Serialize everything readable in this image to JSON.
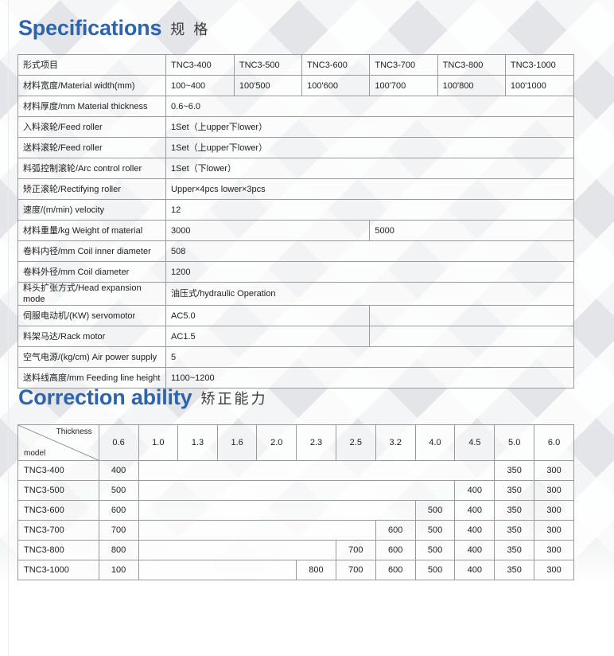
{
  "theme": {
    "heading_color": "#2e63ad",
    "zh_heading_color": "#3b3b3b",
    "border_color": "#9a9a9a",
    "page_background": "#ffffff",
    "band_background": "#f4f5f6"
  },
  "sections": {
    "specifications": {
      "heading_en": "Specifications",
      "heading_zh": "规 格",
      "table": {
        "header": {
          "label": "形式项目",
          "models": [
            "TNC3-400",
            "TNC3-500",
            "TNC3-600",
            "TNC3-700",
            "TNC3-800",
            "TNC3-1000"
          ]
        },
        "rows": [
          {
            "label": "材料宽度/Material width(mm)",
            "type": "per-model",
            "values": [
              "100~400",
              "100'500",
              "100'600",
              "100'700",
              "100'800",
              "100'1000"
            ]
          },
          {
            "label": "材料厚度/mm Material thickness",
            "type": "span-all",
            "value": "0.6~6.0"
          },
          {
            "label": "入料滚轮/Feed roller",
            "type": "span-all",
            "value": "1Set（上upper下lower）"
          },
          {
            "label": "送料滚轮/Feed roller",
            "type": "span-all",
            "value": "1Set（上upper下lower）"
          },
          {
            "label": "料弧控制滚轮/Arc control roller",
            "type": "span-all",
            "value": "1Set（下lower）"
          },
          {
            "label": "矫正滚轮/Rectifying roller",
            "type": "span-all",
            "value": "Upper×4pcs   lower×3pcs"
          },
          {
            "label": "速度/(m/min) velocity",
            "type": "span-all",
            "value": "12"
          },
          {
            "label": "材料重量/kg Weight of material",
            "type": "split-half",
            "value_left": "3000",
            "value_right": "5000"
          },
          {
            "label": "卷料内径/mm Coil inner diameter",
            "type": "span-all",
            "value": "508"
          },
          {
            "label": "卷料外径/mm Coil diameter",
            "type": "span-all",
            "value": "1200"
          },
          {
            "label": "料头扩张方式/Head expansion mode",
            "type": "span-all",
            "value": "油压式/hydraulic Operation"
          },
          {
            "label": "伺服电动机/(KW) servomotor",
            "type": "split-half",
            "value_left": "AC5.0",
            "value_right": ""
          },
          {
            "label": "料架马达/Rack motor",
            "type": "split-half",
            "value_left": "AC1.5",
            "value_right": ""
          },
          {
            "label": "空气电源/(kg/cm) Air power supply",
            "type": "span-all",
            "value": "5"
          },
          {
            "label": "送料线高度/mm Feeding line height",
            "type": "span-all",
            "value": "1100~1200"
          }
        ]
      }
    },
    "correction_ability": {
      "heading_en": "Correction ability",
      "heading_zh": "矫正能力",
      "table": {
        "corner": {
          "top_right": "Thickness",
          "bottom_left": "model"
        },
        "thickness_columns": [
          "0.6",
          "1.0",
          "1.3",
          "1.6",
          "2.0",
          "2.3",
          "2.5",
          "3.2",
          "4.0",
          "4.5",
          "5.0",
          "6.0"
        ],
        "rows": [
          {
            "model": "TNC3-400",
            "values": [
              "400",
              "",
              "",
              "",
              "",
              "",
              "",
              "",
              "",
              "",
              "350",
              "300"
            ]
          },
          {
            "model": "TNC3-500",
            "values": [
              "500",
              "",
              "",
              "",
              "",
              "",
              "",
              "",
              "",
              "400",
              "350",
              "300"
            ]
          },
          {
            "model": "TNC3-600",
            "values": [
              "600",
              "",
              "",
              "",
              "",
              "",
              "",
              "",
              "500",
              "400",
              "350",
              "300"
            ]
          },
          {
            "model": "TNC3-700",
            "values": [
              "700",
              "",
              "",
              "",
              "",
              "",
              "",
              "600",
              "500",
              "400",
              "350",
              "300"
            ]
          },
          {
            "model": "TNC3-800",
            "values": [
              "800",
              "",
              "",
              "",
              "",
              "",
              "700",
              "600",
              "500",
              "400",
              "350",
              "300"
            ]
          },
          {
            "model": "TNC3-1000",
            "values": [
              "100",
              "",
              "",
              "",
              "",
              "800",
              "700",
              "600",
              "500",
              "400",
              "350",
              "300"
            ]
          }
        ]
      }
    }
  }
}
